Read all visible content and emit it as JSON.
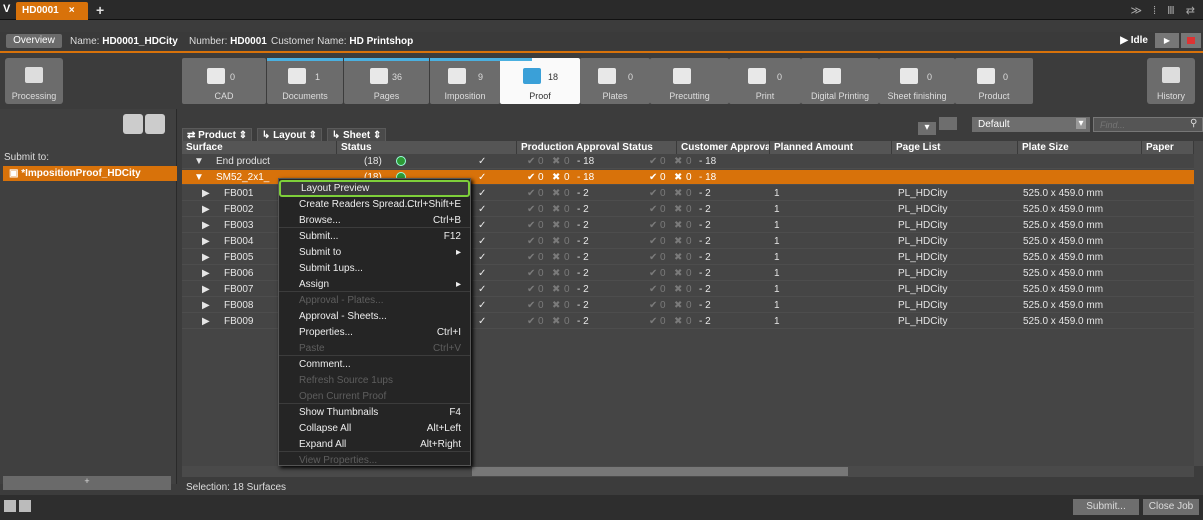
{
  "tab": {
    "title": "HD0001",
    "close": "×",
    "add": "+"
  },
  "info": {
    "overview": "Overview",
    "name_label": "Name:",
    "name": "HD0001_HDCity",
    "number_label": "Number:",
    "number": "HD0001",
    "customer_label": "Customer Name:",
    "customer": "HD Printshop",
    "state": "Idle"
  },
  "steps": [
    {
      "label": "CAD",
      "count": "0",
      "progress": 0
    },
    {
      "label": "Documents",
      "count": "1",
      "progress": 1
    },
    {
      "label": "Pages",
      "count": "36",
      "progress": 1
    },
    {
      "label": "Imposition",
      "count": "9",
      "progress": 1
    },
    {
      "label": "Proof",
      "count": "18",
      "progress": 0.4
    },
    {
      "label": "Plates",
      "count": "0",
      "progress": 0
    },
    {
      "label": "Precutting",
      "count": "",
      "progress": 0
    },
    {
      "label": "Print",
      "count": "0",
      "progress": 0
    },
    {
      "label": "Digital Printing",
      "count": "",
      "progress": 0
    },
    {
      "label": "Sheet finishing",
      "count": "0",
      "progress": 0
    },
    {
      "label": "Product",
      "count": "0",
      "progress": 0
    }
  ],
  "processing": "Processing",
  "history": "History",
  "left": {
    "submit_to": "Submit to:",
    "item": "*ImpositionProof_HDCity",
    "bottom": "+"
  },
  "filters": {
    "product": "Product",
    "layout": "Layout",
    "sheet": "Sheet",
    "default": "Default",
    "find_placeholder": "Find..."
  },
  "columns": [
    "Surface",
    "Status",
    "Production Approval Status",
    "Customer Approval Status",
    "Planned Amount",
    "Page List",
    "Plate Size",
    "Paper"
  ],
  "rows": [
    {
      "surface": "End product",
      "count": "(18)",
      "pa": "0",
      "pr": "0",
      "pn": "- 18",
      "ca": "0",
      "cr": "0",
      "cn": "- 18",
      "amount": "",
      "pages": "",
      "plate": ""
    },
    {
      "surface": "SM52_2x1_",
      "count": "(18)",
      "pa": "0",
      "pr": "0",
      "pn": "- 18",
      "ca": "0",
      "cr": "0",
      "cn": "- 18",
      "amount": "",
      "pages": "",
      "plate": ""
    },
    {
      "surface": "FB001",
      "count": "",
      "pa": "0",
      "pr": "0",
      "pn": "- 2",
      "ca": "0",
      "cr": "0",
      "cn": "- 2",
      "amount": "1",
      "pages": "PL_HDCity",
      "plate": "525.0 x 459.0 mm"
    },
    {
      "surface": "FB002",
      "count": "",
      "pa": "0",
      "pr": "0",
      "pn": "- 2",
      "ca": "0",
      "cr": "0",
      "cn": "- 2",
      "amount": "1",
      "pages": "PL_HDCity",
      "plate": "525.0 x 459.0 mm"
    },
    {
      "surface": "FB003",
      "count": "",
      "pa": "0",
      "pr": "0",
      "pn": "- 2",
      "ca": "0",
      "cr": "0",
      "cn": "- 2",
      "amount": "1",
      "pages": "PL_HDCity",
      "plate": "525.0 x 459.0 mm"
    },
    {
      "surface": "FB004",
      "count": "",
      "pa": "0",
      "pr": "0",
      "pn": "- 2",
      "ca": "0",
      "cr": "0",
      "cn": "- 2",
      "amount": "1",
      "pages": "PL_HDCity",
      "plate": "525.0 x 459.0 mm"
    },
    {
      "surface": "FB005",
      "count": "",
      "pa": "0",
      "pr": "0",
      "pn": "- 2",
      "ca": "0",
      "cr": "0",
      "cn": "- 2",
      "amount": "1",
      "pages": "PL_HDCity",
      "plate": "525.0 x 459.0 mm"
    },
    {
      "surface": "FB006",
      "count": "",
      "pa": "0",
      "pr": "0",
      "pn": "- 2",
      "ca": "0",
      "cr": "0",
      "cn": "- 2",
      "amount": "1",
      "pages": "PL_HDCity",
      "plate": "525.0 x 459.0 mm"
    },
    {
      "surface": "FB007",
      "count": "",
      "pa": "0",
      "pr": "0",
      "pn": "- 2",
      "ca": "0",
      "cr": "0",
      "cn": "- 2",
      "amount": "1",
      "pages": "PL_HDCity",
      "plate": "525.0 x 459.0 mm"
    },
    {
      "surface": "FB008",
      "count": "",
      "pa": "0",
      "pr": "0",
      "pn": "- 2",
      "ca": "0",
      "cr": "0",
      "cn": "- 2",
      "amount": "1",
      "pages": "PL_HDCity",
      "plate": "525.0 x 459.0 mm"
    },
    {
      "surface": "FB009",
      "count": "",
      "pa": "0",
      "pr": "0",
      "pn": "- 2",
      "ca": "0",
      "cr": "0",
      "cn": "- 2",
      "amount": "1",
      "pages": "PL_HDCity",
      "plate": "525.0 x 459.0 mm"
    }
  ],
  "menu": [
    {
      "label": "Layout Preview",
      "shortcut": "",
      "state": "highlighted"
    },
    {
      "label": "Create Readers Spread...",
      "shortcut": "Ctrl+Shift+E",
      "state": "enabled"
    },
    {
      "label": "Browse...",
      "shortcut": "Ctrl+B",
      "state": "enabled"
    },
    {
      "label": "Submit...",
      "shortcut": "F12",
      "state": "enabled"
    },
    {
      "label": "Submit to",
      "shortcut": "▸",
      "state": "enabled"
    },
    {
      "label": "Submit 1ups...",
      "shortcut": "",
      "state": "enabled"
    },
    {
      "label": "Assign",
      "shortcut": "▸",
      "state": "enabled"
    },
    {
      "label": "Approval - Plates...",
      "shortcut": "",
      "state": "disabled"
    },
    {
      "label": "Approval - Sheets...",
      "shortcut": "",
      "state": "enabled"
    },
    {
      "label": "Properties...",
      "shortcut": "Ctrl+I",
      "state": "enabled"
    },
    {
      "label": "Paste",
      "shortcut": "Ctrl+V",
      "state": "disabled"
    },
    {
      "label": "Comment...",
      "shortcut": "",
      "state": "enabled"
    },
    {
      "label": "Refresh Source 1ups",
      "shortcut": "",
      "state": "disabled"
    },
    {
      "label": "Open Current Proof",
      "shortcut": "",
      "state": "disabled"
    },
    {
      "label": "Show Thumbnails",
      "shortcut": "F4",
      "state": "enabled"
    },
    {
      "label": "Collapse All",
      "shortcut": "Alt+Left",
      "state": "enabled"
    },
    {
      "label": "Expand All",
      "shortcut": "Alt+Right",
      "state": "enabled"
    },
    {
      "label": "View Properties...",
      "shortcut": "",
      "state": "disabled"
    }
  ],
  "status": "Selection:  18 Surfaces",
  "buttons": {
    "submit": "Submit...",
    "close": "Close Job"
  },
  "colors": {
    "accent": "#d8720a",
    "highlight_border": "#7ecf3a",
    "status_ok": "#2d9a35",
    "progress": "#4ab0e0"
  }
}
